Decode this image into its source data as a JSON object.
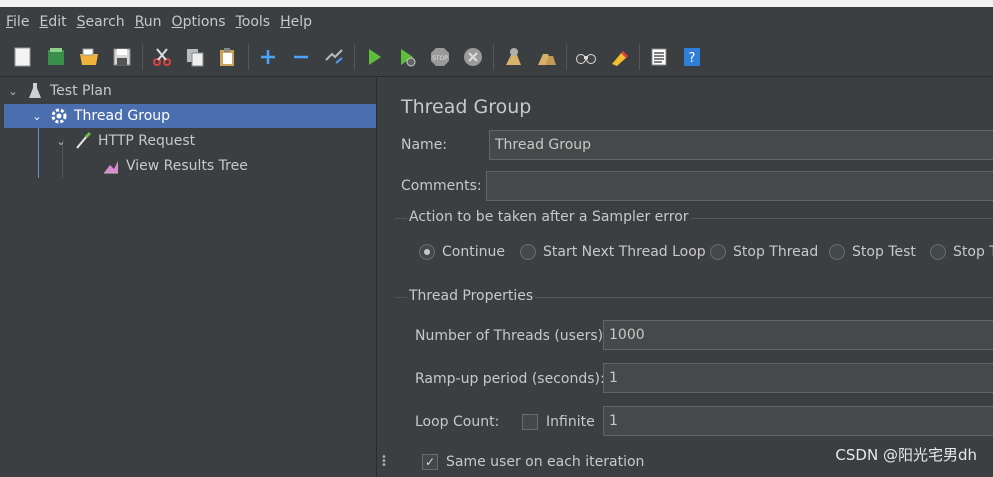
{
  "menu": [
    {
      "label": "File",
      "mnemonic": "F",
      "rest": "ile"
    },
    {
      "label": "Edit",
      "mnemonic": "E",
      "rest": "dit"
    },
    {
      "label": "Search",
      "mnemonic": "S",
      "rest": "earch"
    },
    {
      "label": "Run",
      "mnemonic": "R",
      "rest": "un"
    },
    {
      "label": "Options",
      "mnemonic": "O",
      "rest": "ptions"
    },
    {
      "label": "Tools",
      "mnemonic": "T",
      "rest": "ools"
    },
    {
      "label": "Help",
      "mnemonic": "H",
      "rest": "elp"
    }
  ],
  "toolbar": {
    "icons": [
      "new-icon",
      "templates-icon",
      "open-icon",
      "save-icon",
      "cut-icon",
      "copy-icon",
      "paste-icon",
      "expand-icon",
      "collapse-icon",
      "toggle-icon",
      "start-icon",
      "start-no-pauses-icon",
      "stop-icon",
      "shutdown-icon",
      "clear-icon",
      "clear-all-icon",
      "search-icon",
      "reset-search-icon",
      "function-helper-icon",
      "help-icon"
    ]
  },
  "tree": {
    "items": [
      {
        "label": "Test Plan",
        "icon": "flask-icon",
        "expanded": true,
        "selected": false
      },
      {
        "label": "Thread Group",
        "icon": "gear-icon",
        "expanded": true,
        "selected": true
      },
      {
        "label": "HTTP Request",
        "icon": "pipette-icon",
        "expanded": true,
        "selected": false
      },
      {
        "label": "View Results Tree",
        "icon": "results-tree-icon",
        "expanded": false,
        "selected": false
      }
    ]
  },
  "panel": {
    "title": "Thread Group",
    "name_label": "Name:",
    "name_value": "Thread Group",
    "comments_label": "Comments:",
    "comments_value": "",
    "error_action": {
      "title": "Action to be taken after a Sampler error",
      "options": [
        "Continue",
        "Start Next Thread Loop",
        "Stop Thread",
        "Stop Test",
        "Stop T"
      ],
      "selected": "Continue"
    },
    "thread_props": {
      "title": "Thread Properties",
      "threads_label": "Number of Threads (users):",
      "threads_value": "1000",
      "rampup_label": "Ramp-up period (seconds):",
      "rampup_value": "1",
      "loop_label": "Loop Count:",
      "infinite_label": "Infinite",
      "infinite_checked": false,
      "loop_value": "1",
      "same_user_label": "Same user on each iteration",
      "same_user_checked": true
    }
  },
  "watermark": "CSDN @阳光宅男dh",
  "colors": {
    "background": "#3c3f41",
    "selection": "#4b6eaf",
    "field": "#45494a",
    "start_green": "#5fbd3c",
    "help_blue": "#2f7fd8"
  }
}
